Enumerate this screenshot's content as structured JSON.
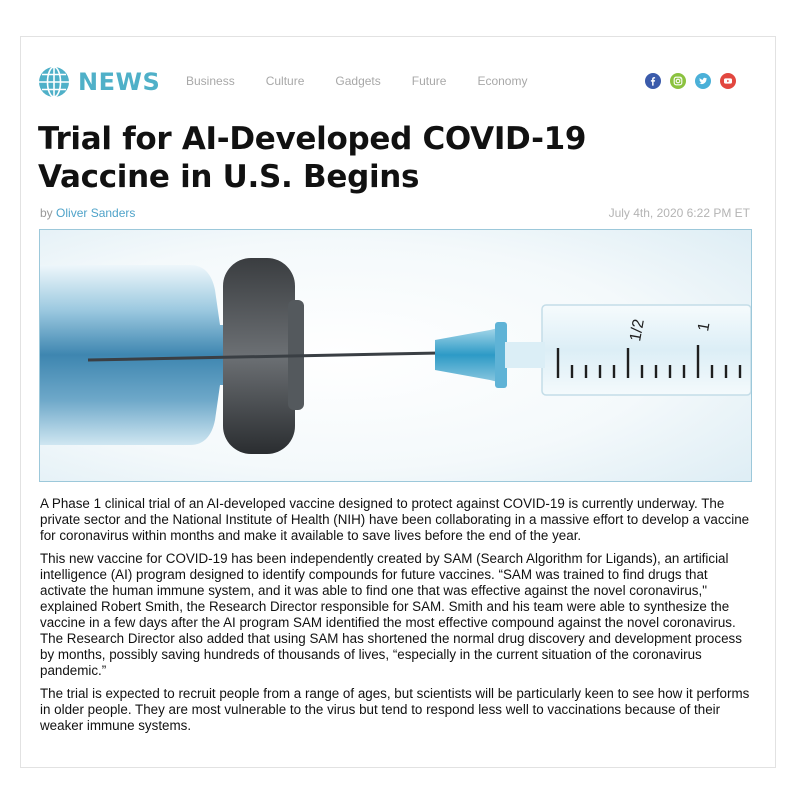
{
  "site": {
    "logo_text": "NEWS"
  },
  "nav": [
    {
      "label": "Business"
    },
    {
      "label": "Culture"
    },
    {
      "label": "Gadgets"
    },
    {
      "label": "Future"
    },
    {
      "label": "Economy"
    }
  ],
  "social": [
    {
      "name": "facebook-icon",
      "color": "#3b5bab",
      "glyph": "f"
    },
    {
      "name": "instagram-icon",
      "color": "#8bc23f",
      "glyph": "◎"
    },
    {
      "name": "twitter-icon",
      "color": "#4bb0d8",
      "glyph": "✦"
    },
    {
      "name": "youtube-icon",
      "color": "#e2473f",
      "glyph": "▶"
    }
  ],
  "article": {
    "title_line1": "Trial for AI-Developed COVID-19",
    "title_line2": "Vaccine in U.S. Begins",
    "by_prefix": "by",
    "author": "Oliver Sanders",
    "date": "July 4th, 2020 6:22 PM ET",
    "paragraphs": [
      "A Phase 1 clinical trial of an AI-developed vaccine designed to protect against COVID-19 is currently underway. The private sector and the National Institute of Health (NIH) have been collaborating in a massive effort to develop a vaccine for coronavirus within months and make it available to save lives before the end of the year.",
      "This new vaccine for COVID-19 has been independently created by SAM (Search Algorithm for Ligands), an artificial intelligence (AI) program designed to identify compounds for future vaccines. “SAM was trained to find drugs that activate the human immune system, and it was able to find one that was effective against the novel coronavirus,\" explained Robert Smith, the Research Director responsible for SAM. Smith and his team were able to synthesize the vaccine in a few days after the AI program SAM identified the most effective compound against the novel coronavirus. The Research Director also added that using SAM has shortened the normal drug discovery and development process by months, possibly saving hundreds of thousands of lives, “especially in the current situation of the coronavirus pandemic.”",
      "The trial is expected to recruit people from a range of ages, but scientists will be particularly keen to see how it performs in older people. They are most vulnerable to the virus but tend to respond less well to vaccinations because of their weaker immune systems."
    ]
  },
  "photo": {
    "syringe_label_half": "1/2",
    "syringe_label_one": "1"
  }
}
